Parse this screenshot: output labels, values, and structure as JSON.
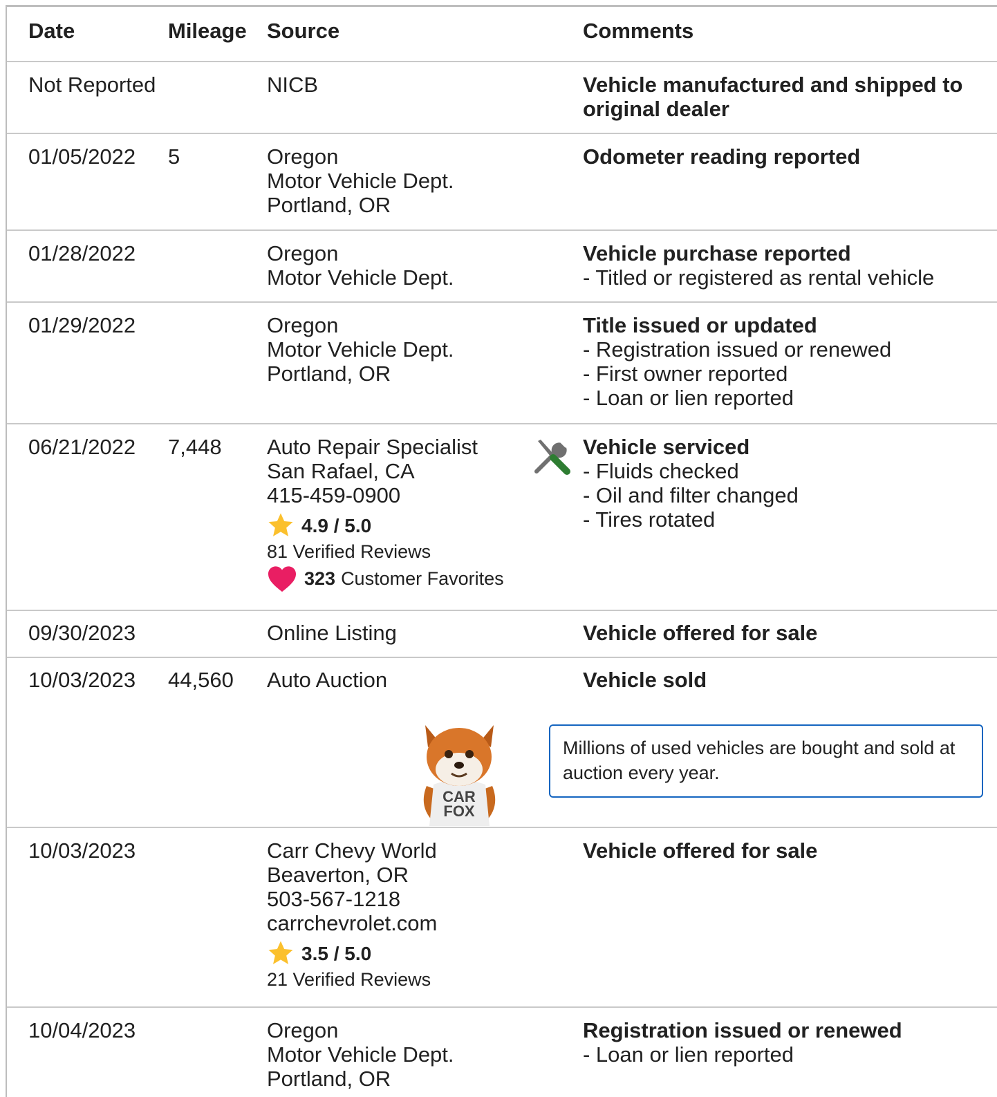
{
  "header": {
    "date": "Date",
    "mileage": "Mileage",
    "source": "Source",
    "comments": "Comments"
  },
  "rows": [
    {
      "date": "Not Reported",
      "mileage": "",
      "source": [
        "NICB"
      ],
      "title": "Vehicle manufactured and shipped to original dealer",
      "details": []
    },
    {
      "date": "01/05/2022",
      "mileage": "5",
      "source": [
        "Oregon",
        "Motor Vehicle Dept.",
        "Portland, OR"
      ],
      "title": "Odometer reading reported",
      "details": []
    },
    {
      "date": "01/28/2022",
      "mileage": "",
      "source": [
        "Oregon",
        "Motor Vehicle Dept."
      ],
      "title": "Vehicle purchase reported",
      "details": [
        "- Titled or registered as rental vehicle"
      ]
    },
    {
      "date": "01/29/2022",
      "mileage": "",
      "source": [
        "Oregon",
        "Motor Vehicle Dept.",
        "Portland, OR"
      ],
      "title": "Title issued or updated",
      "details": [
        "- Registration issued or renewed",
        "- First owner reported",
        "- Loan or lien reported"
      ]
    },
    {
      "date": "06/21/2022",
      "mileage": "7,448",
      "source": [
        "Auto Repair Specialist",
        "San Rafael, CA",
        "415-459-0900"
      ],
      "rating": "4.9 / 5.0",
      "reviews": "81 Verified Reviews",
      "favorites_count": "323",
      "favorites_label": "Customer Favorites",
      "icon": "wrench-screwdriver-icon",
      "title": "Vehicle serviced",
      "details": [
        "- Fluids checked",
        "- Oil and filter changed",
        "- Tires rotated"
      ]
    },
    {
      "date": "09/30/2023",
      "mileage": "",
      "source": [
        "Online Listing"
      ],
      "title": "Vehicle offered for sale",
      "details": []
    },
    {
      "date": "10/03/2023",
      "mileage": "44,560",
      "source": [
        "Auto Auction"
      ],
      "title": "Vehicle sold",
      "details": [],
      "mascot_text": [
        "CAR",
        "FOX"
      ],
      "callout": "Millions of used vehicles are bought and sold at auction every year."
    },
    {
      "date": "10/03/2023",
      "mileage": "",
      "source": [
        "Carr Chevy World",
        "Beaverton, OR",
        "503-567-1218",
        "carrchevrolet.com"
      ],
      "rating": "3.5 / 5.0",
      "reviews": "21 Verified Reviews",
      "title": "Vehicle offered for sale",
      "details": []
    },
    {
      "date": "10/04/2023",
      "mileage": "",
      "source": [
        "Oregon",
        "Motor Vehicle Dept.",
        "Portland, OR"
      ],
      "title": "Registration issued or renewed",
      "details": [
        "- Loan or lien reported"
      ]
    }
  ],
  "colors": {
    "star": "#fbc02d",
    "heart": "#e91e63",
    "callout_border": "#1565c0",
    "rule": "#c9c9c9"
  }
}
